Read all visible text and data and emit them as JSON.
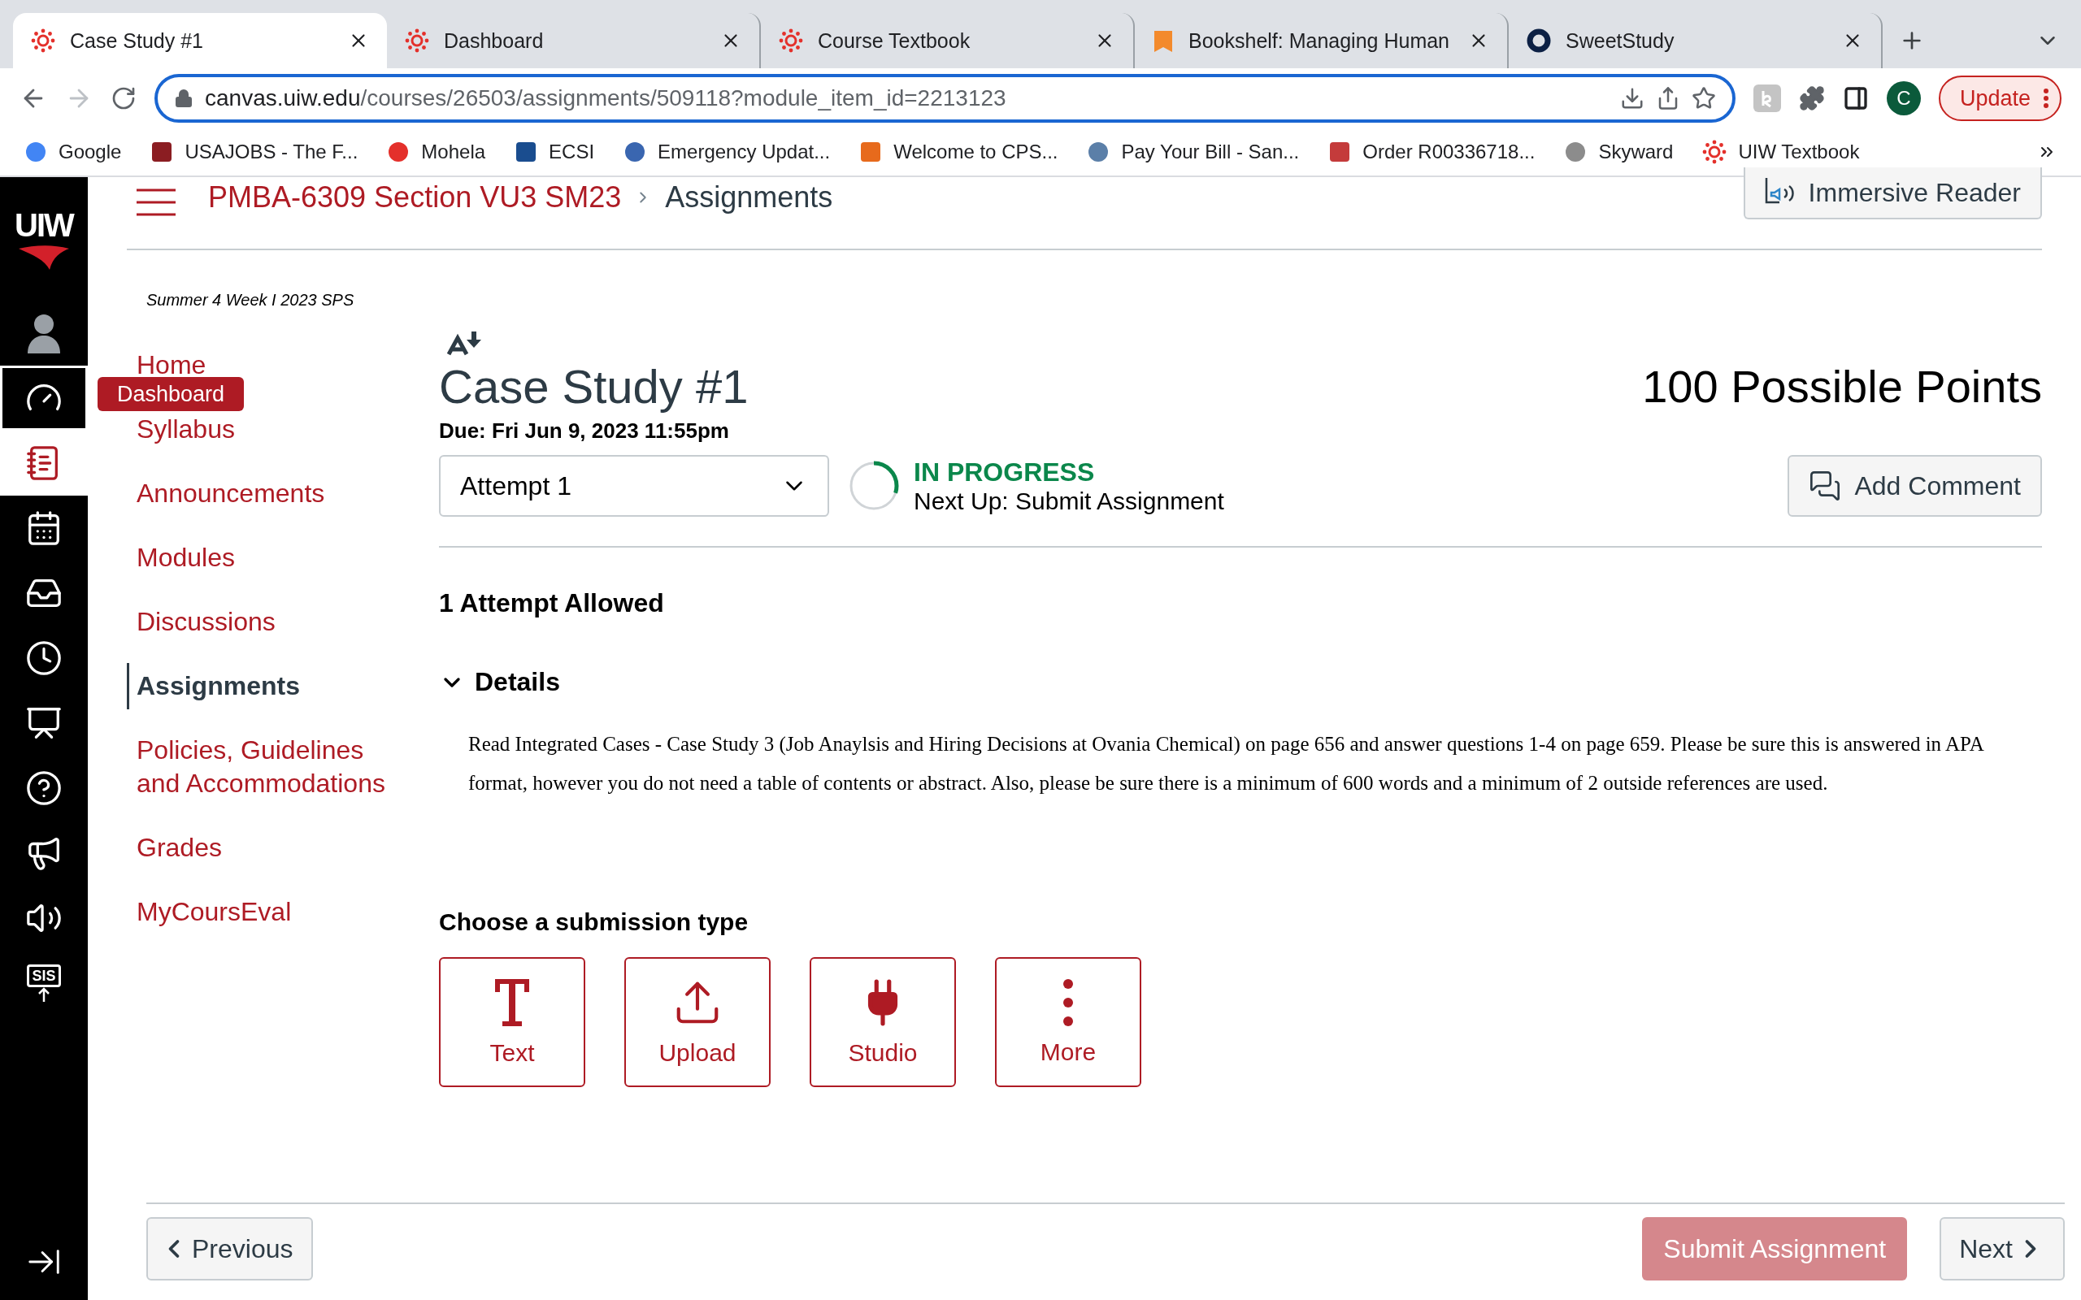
{
  "browser": {
    "tabs": [
      {
        "title": "Case Study #1",
        "selected": true
      },
      {
        "title": "Dashboard",
        "selected": false
      },
      {
        "title": "Course Textbook",
        "selected": false
      },
      {
        "title": "Bookshelf: Managing Human",
        "selected": false
      },
      {
        "title": "SweetStudy",
        "selected": false
      }
    ],
    "address": {
      "host": "canvas.uiw.edu",
      "path": "/courses/26503/assignments/509118?module_item_id=2213123"
    },
    "profile": "C",
    "update": "Update",
    "bookmarks": [
      {
        "label": "Google"
      },
      {
        "label": "USAJOBS - The F..."
      },
      {
        "label": "Mohela"
      },
      {
        "label": "ECSI"
      },
      {
        "label": "Emergency Updat..."
      },
      {
        "label": "Welcome to CPS..."
      },
      {
        "label": "Pay Your Bill - San..."
      },
      {
        "label": "Order R00336718..."
      },
      {
        "label": "Skyward"
      },
      {
        "label": "UIW Textbook"
      }
    ]
  },
  "global_nav": {
    "logo": "UIW",
    "items": [
      {
        "kind": "account",
        "selected": false,
        "focused": false
      },
      {
        "kind": "dashboard",
        "selected": false,
        "focused": true
      },
      {
        "kind": "courses",
        "selected": true,
        "focused": false
      },
      {
        "kind": "calendar",
        "selected": false,
        "focused": false
      },
      {
        "kind": "inbox",
        "selected": false,
        "focused": false
      },
      {
        "kind": "history",
        "selected": false,
        "focused": false
      },
      {
        "kind": "studio",
        "selected": false,
        "focused": false
      },
      {
        "kind": "help",
        "selected": false,
        "focused": false
      },
      {
        "kind": "announce",
        "selected": false,
        "focused": false
      },
      {
        "kind": "audio",
        "selected": false,
        "focused": false
      },
      {
        "kind": "sis",
        "selected": false,
        "focused": false,
        "label": "SIS"
      }
    ],
    "tooltip": "Dashboard"
  },
  "breadcrumb": [
    "PMBA-6309 Section VU3 SM23",
    "Assignments"
  ],
  "immersive_reader": "Immersive Reader",
  "course_nav": {
    "term": "Summer 4 Week I 2023 SPS",
    "items": [
      {
        "label": "Home",
        "selected": false
      },
      {
        "label": "Syllabus",
        "selected": false
      },
      {
        "label": "Announcements",
        "selected": false
      },
      {
        "label": "Modules",
        "selected": false
      },
      {
        "label": "Discussions",
        "selected": false
      },
      {
        "label": "Assignments",
        "selected": true
      },
      {
        "label": "Policies, Guidelines and Accommodations",
        "selected": false
      },
      {
        "label": "Grades",
        "selected": false
      },
      {
        "label": "MyCoursEval",
        "selected": false
      }
    ]
  },
  "assignment": {
    "title": "Case Study #1",
    "points": "100 Possible Points",
    "due": "Due: Fri Jun 9, 2023 11:55pm",
    "attempt": "Attempt 1",
    "status": "IN PROGRESS",
    "next_up": "Next Up: Submit Assignment",
    "add_comment": "Add Comment",
    "attempts_allowed": "1 Attempt Allowed",
    "details_heading": "Details",
    "details_expanded": true,
    "details": "Read Integrated Cases - Case Study 3 (Job Anaylsis and Hiring Decisions at Ovania Chemical) on page 656 and answer questions 1-4 on page 659. Please be sure this is answered in APA format, however you do not need a table of contents or abstract. Also, please be sure there is a minimum of 600 words and a minimum of 2 outside references are used.",
    "submission_heading": "Choose a submission type",
    "submission_types": [
      {
        "kind": "text",
        "label": "Text"
      },
      {
        "kind": "upload",
        "label": "Upload"
      },
      {
        "kind": "studio",
        "label": "Studio"
      },
      {
        "kind": "more",
        "label": "More"
      }
    ]
  },
  "footer": {
    "previous": "Previous",
    "submit": "Submit Assignment",
    "submit_disabled": true,
    "next": "Next"
  }
}
